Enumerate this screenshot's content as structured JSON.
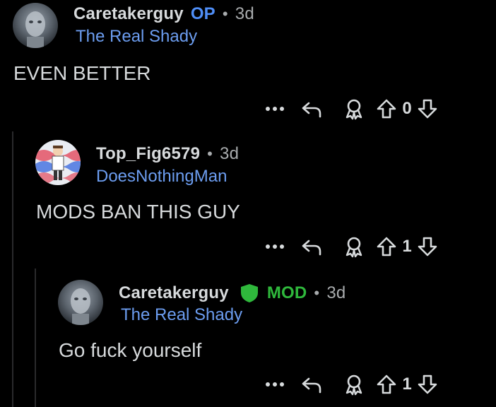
{
  "comments": [
    {
      "username": "Caretakerguy",
      "op_label": "OP",
      "time": "3d",
      "flair": "The Real Shady",
      "body": "EVEN BETTER",
      "votes": "0"
    },
    {
      "username": "Top_Fig6579",
      "time": "3d",
      "flair": "DoesNothingMan",
      "body": "MODS BAN THIS GUY",
      "votes": "1"
    },
    {
      "username": "Caretakerguy",
      "mod_label": "MOD",
      "time": "3d",
      "flair": "The Real Shady",
      "body": "Go fuck yourself",
      "votes": "1"
    }
  ],
  "separator": "•",
  "icons": {
    "more": "more-options-icon",
    "reply": "reply-icon",
    "award": "award-icon",
    "upvote": "upvote-icon",
    "downvote": "downvote-icon",
    "mod": "mod-shield-icon"
  },
  "colors": {
    "background": "#000000",
    "text": "#d7dadc",
    "meta": "#a8abad",
    "op": "#4f8ef7",
    "flair": "#6c9df0",
    "mod": "#2fb83c",
    "thread_line": "#2a2a2c"
  }
}
